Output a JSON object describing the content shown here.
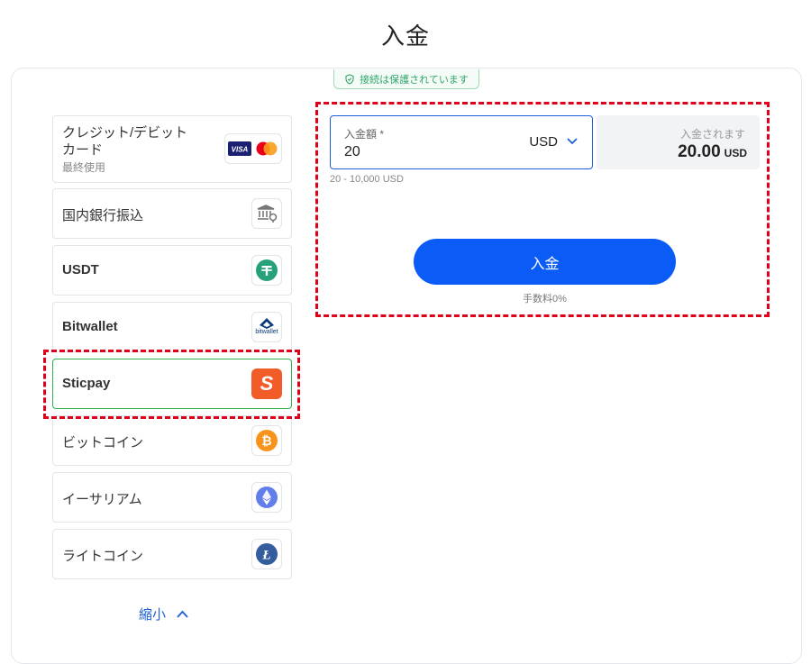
{
  "header": {
    "title": "入金"
  },
  "secure_badge": {
    "text": "接続は保護されています",
    "icon": "shield-check-icon"
  },
  "methods": [
    {
      "label": "クレジット/デビットカード",
      "sub": "最終使用",
      "icons": [
        "visa-icon",
        "mastercard-icon"
      ]
    },
    {
      "label": "国内銀行振込",
      "icon": "bank-icon"
    },
    {
      "label": "USDT",
      "icon": "tether-icon",
      "color": "#26a17b"
    },
    {
      "label": "Bitwallet",
      "icon": "bitwallet-icon",
      "icon_text": "bitwallet"
    },
    {
      "label": "Sticpay",
      "icon": "sticpay-icon",
      "color": "#f25c29",
      "selected": true
    },
    {
      "label": "ビットコイン",
      "icon": "bitcoin-icon",
      "color": "#f7931a"
    },
    {
      "label": "イーサリアム",
      "icon": "ethereum-icon",
      "color": "#627eea"
    },
    {
      "label": "ライトコイン",
      "icon": "litecoin-icon",
      "color": "#345d9d"
    }
  ],
  "form": {
    "amount_label": "入金額 *",
    "amount_value": "20",
    "currency": "USD",
    "range_hint": "20 - 10,000 USD",
    "receive_label": "入金されます",
    "receive_value": "20.00",
    "receive_unit": "USD",
    "submit_label": "入金",
    "fee_note": "手数料0%"
  },
  "collapse": {
    "label": "縮小",
    "icon": "chevron-up-icon"
  },
  "colors": {
    "accent": "#0b5cf6",
    "secure": "#2fa66a",
    "highlight": "#e0001a",
    "selected_border": "#2bb24c"
  }
}
